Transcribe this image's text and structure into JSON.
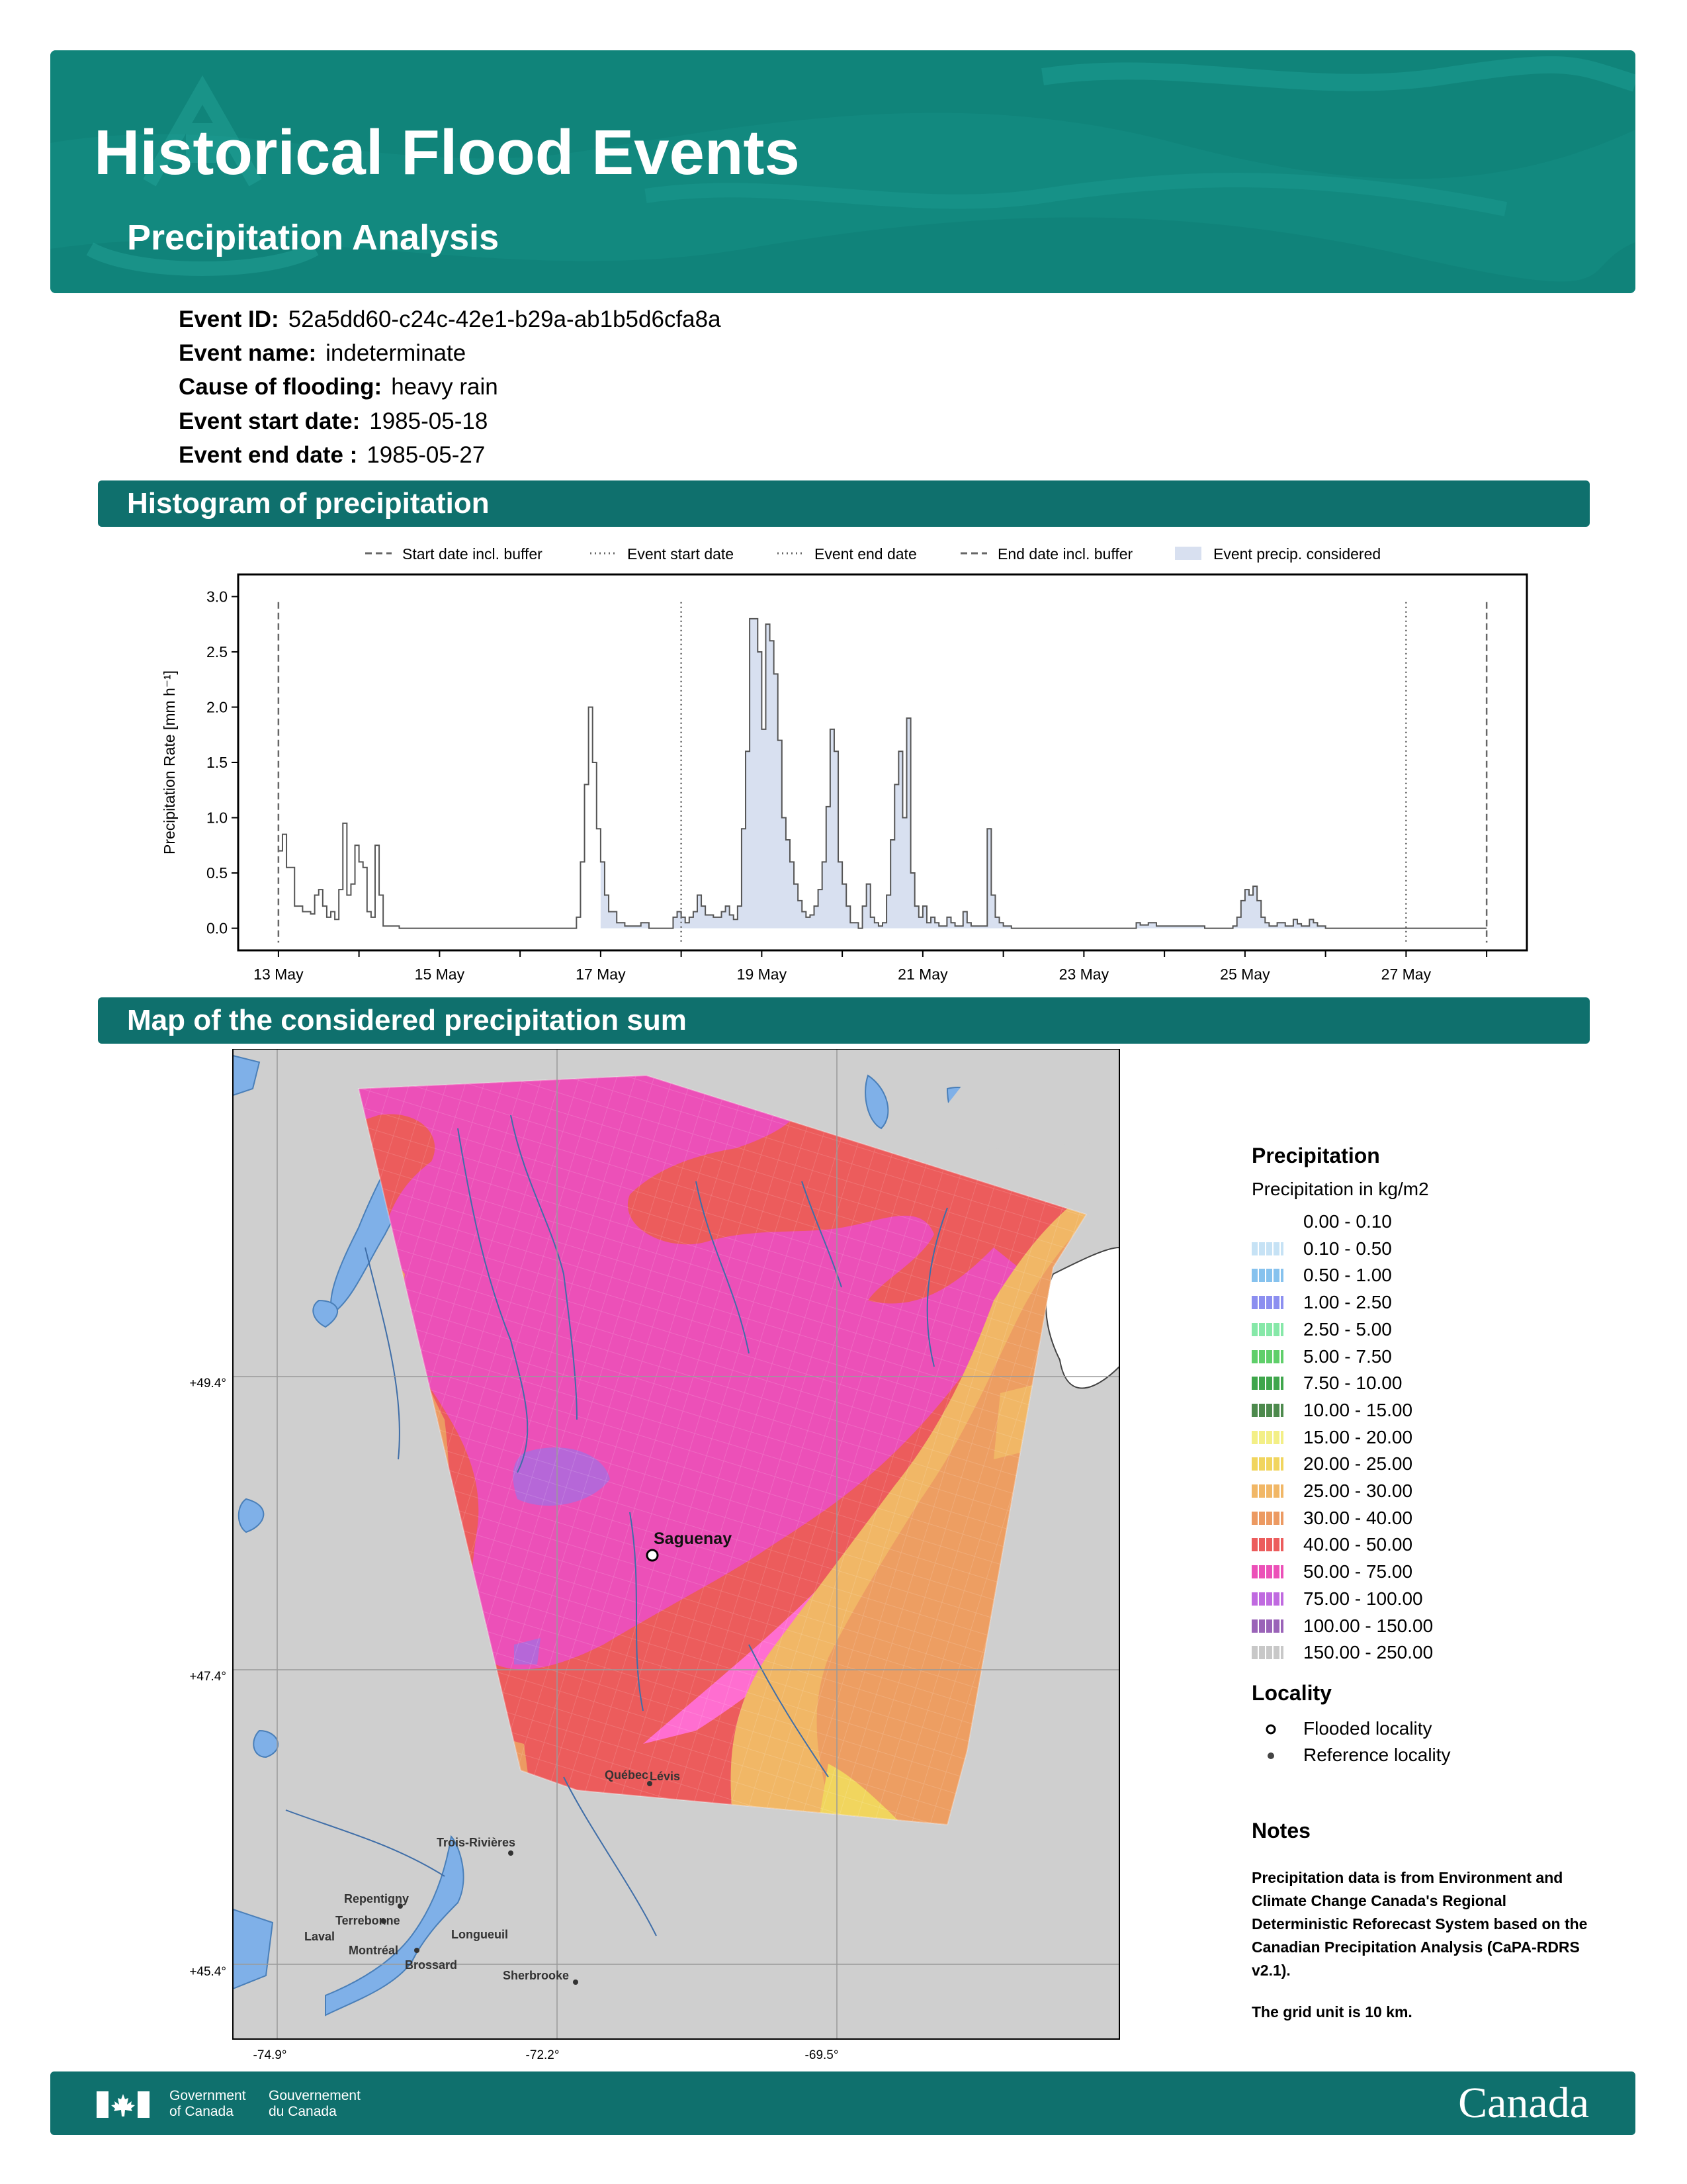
{
  "header": {
    "title": "Historical Flood Events",
    "subtitle": "Precipitation Analysis",
    "brand_color": "#12897f"
  },
  "event": {
    "id_label": "Event ID:",
    "id": "52a5dd60-c24c-42e1-b29a-ab1b5d6cfa8a",
    "name_label": "Event name:",
    "name": "indeterminate",
    "cause_label": "Cause of flooding:",
    "cause": "heavy rain",
    "start_label": "Event start date:",
    "start": "1985-05-18",
    "end_label": "Event end date :",
    "end": "1985-05-27"
  },
  "sections": {
    "histogram": "Histogram of precipitation",
    "map": "Map of the considered precipitation sum"
  },
  "chart_data": {
    "type": "area",
    "title": "",
    "xlabel": "",
    "ylabel": "Precipitation Rate [mm h⁻¹]",
    "ylim": [
      0,
      3.0
    ],
    "xlim": [
      12.5,
      28.5
    ],
    "yticks": [
      "0.0",
      "0.5",
      "1.0",
      "1.5",
      "2.0",
      "2.5",
      "3.0"
    ],
    "xticks": [
      {
        "v": 13,
        "label": "13 May"
      },
      {
        "v": 15,
        "label": "15 May"
      },
      {
        "v": 17,
        "label": "17 May"
      },
      {
        "v": 19,
        "label": "19 May"
      },
      {
        "v": 21,
        "label": "21 May"
      },
      {
        "v": 23,
        "label": "23 May"
      },
      {
        "v": 25,
        "label": "25 May"
      },
      {
        "v": 27,
        "label": "27 May"
      }
    ],
    "legend": [
      "Start date incl. buffer",
      "Event start date",
      "Event end date",
      "End date incl. buffer",
      "Event precip. considered"
    ],
    "legend_placement": "top",
    "vlines": [
      {
        "x": 13.0,
        "style": "dashed"
      },
      {
        "x": 18.0,
        "style": "dotted"
      },
      {
        "x": 27.0,
        "style": "dotted"
      },
      {
        "x": 28.0,
        "style": "dashed"
      }
    ],
    "fill_range": [
      17.0,
      28.0
    ],
    "series": [
      {
        "values": [
          [
            13.0,
            0.7
          ],
          [
            13.05,
            0.85
          ],
          [
            13.1,
            0.55
          ],
          [
            13.15,
            0.55
          ],
          [
            13.2,
            0.2
          ],
          [
            13.3,
            0.15
          ],
          [
            13.4,
            0.13
          ],
          [
            13.45,
            0.3
          ],
          [
            13.5,
            0.35
          ],
          [
            13.55,
            0.2
          ],
          [
            13.6,
            0.1
          ],
          [
            13.65,
            0.15
          ],
          [
            13.7,
            0.08
          ],
          [
            13.75,
            0.35
          ],
          [
            13.8,
            0.95
          ],
          [
            13.85,
            0.3
          ],
          [
            13.9,
            0.4
          ],
          [
            13.95,
            0.75
          ],
          [
            14.0,
            0.6
          ],
          [
            14.05,
            0.55
          ],
          [
            14.1,
            0.15
          ],
          [
            14.15,
            0.1
          ],
          [
            14.2,
            0.75
          ],
          [
            14.25,
            0.3
          ],
          [
            14.3,
            0.02
          ],
          [
            14.5,
            0.0
          ],
          [
            16.6,
            0.0
          ],
          [
            16.7,
            0.1
          ],
          [
            16.75,
            0.6
          ],
          [
            16.8,
            1.3
          ],
          [
            16.85,
            2.0
          ],
          [
            16.9,
            1.5
          ],
          [
            16.95,
            0.9
          ],
          [
            17.0,
            0.6
          ],
          [
            17.05,
            0.3
          ],
          [
            17.1,
            0.15
          ],
          [
            17.2,
            0.05
          ],
          [
            17.3,
            0.02
          ],
          [
            17.5,
            0.05
          ],
          [
            17.6,
            0.0
          ],
          [
            17.9,
            0.1
          ],
          [
            17.95,
            0.15
          ],
          [
            18.0,
            0.1
          ],
          [
            18.05,
            0.05
          ],
          [
            18.1,
            0.1
          ],
          [
            18.15,
            0.15
          ],
          [
            18.2,
            0.3
          ],
          [
            18.25,
            0.2
          ],
          [
            18.3,
            0.12
          ],
          [
            18.4,
            0.1
          ],
          [
            18.5,
            0.15
          ],
          [
            18.55,
            0.2
          ],
          [
            18.6,
            0.12
          ],
          [
            18.65,
            0.08
          ],
          [
            18.7,
            0.2
          ],
          [
            18.75,
            0.9
          ],
          [
            18.8,
            1.6
          ],
          [
            18.85,
            2.8
          ],
          [
            18.9,
            2.8
          ],
          [
            18.95,
            2.5
          ],
          [
            19.0,
            1.8
          ],
          [
            19.05,
            2.75
          ],
          [
            19.1,
            2.6
          ],
          [
            19.15,
            2.3
          ],
          [
            19.2,
            1.7
          ],
          [
            19.25,
            1.0
          ],
          [
            19.3,
            0.8
          ],
          [
            19.35,
            0.6
          ],
          [
            19.4,
            0.4
          ],
          [
            19.45,
            0.25
          ],
          [
            19.5,
            0.15
          ],
          [
            19.55,
            0.1
          ],
          [
            19.6,
            0.12
          ],
          [
            19.65,
            0.2
          ],
          [
            19.7,
            0.35
          ],
          [
            19.75,
            0.6
          ],
          [
            19.8,
            1.1
          ],
          [
            19.85,
            1.8
          ],
          [
            19.9,
            1.6
          ],
          [
            19.95,
            0.6
          ],
          [
            20.0,
            0.4
          ],
          [
            20.05,
            0.2
          ],
          [
            20.1,
            0.05
          ],
          [
            20.2,
            0.0
          ],
          [
            20.25,
            0.2
          ],
          [
            20.3,
            0.4
          ],
          [
            20.35,
            0.1
          ],
          [
            20.4,
            0.05
          ],
          [
            20.45,
            0.02
          ],
          [
            20.5,
            0.05
          ],
          [
            20.55,
            0.3
          ],
          [
            20.6,
            0.8
          ],
          [
            20.65,
            1.3
          ],
          [
            20.7,
            1.6
          ],
          [
            20.75,
            1.0
          ],
          [
            20.8,
            1.9
          ],
          [
            20.85,
            0.5
          ],
          [
            20.9,
            0.2
          ],
          [
            20.95,
            0.1
          ],
          [
            21.0,
            0.2
          ],
          [
            21.05,
            0.05
          ],
          [
            21.1,
            0.1
          ],
          [
            21.15,
            0.05
          ],
          [
            21.2,
            0.02
          ],
          [
            21.3,
            0.1
          ],
          [
            21.35,
            0.05
          ],
          [
            21.4,
            0.02
          ],
          [
            21.5,
            0.15
          ],
          [
            21.55,
            0.05
          ],
          [
            21.6,
            0.02
          ],
          [
            21.8,
            0.9
          ],
          [
            21.85,
            0.3
          ],
          [
            21.9,
            0.1
          ],
          [
            21.95,
            0.05
          ],
          [
            22.0,
            0.02
          ],
          [
            22.1,
            0.0
          ],
          [
            23.6,
            0.0
          ],
          [
            23.65,
            0.05
          ],
          [
            23.7,
            0.03
          ],
          [
            23.8,
            0.05
          ],
          [
            23.9,
            0.02
          ],
          [
            24.1,
            0.02
          ],
          [
            24.5,
            0.0
          ],
          [
            24.85,
            0.02
          ],
          [
            24.9,
            0.1
          ],
          [
            24.95,
            0.25
          ],
          [
            25.0,
            0.35
          ],
          [
            25.05,
            0.3
          ],
          [
            25.1,
            0.38
          ],
          [
            25.15,
            0.25
          ],
          [
            25.2,
            0.1
          ],
          [
            25.25,
            0.05
          ],
          [
            25.3,
            0.02
          ],
          [
            25.4,
            0.05
          ],
          [
            25.5,
            0.02
          ],
          [
            25.6,
            0.08
          ],
          [
            25.65,
            0.04
          ],
          [
            25.7,
            0.02
          ],
          [
            25.8,
            0.08
          ],
          [
            25.85,
            0.05
          ],
          [
            25.9,
            0.02
          ],
          [
            26.0,
            0.0
          ],
          [
            28.0,
            0.0
          ]
        ]
      }
    ]
  },
  "map": {
    "lat_labels": [
      "+49.4°",
      "+47.4°",
      "+45.4°"
    ],
    "lon_labels": [
      "-74.9°",
      "-72.2°",
      "-69.5°"
    ],
    "cities": {
      "flooded": "Saguenay",
      "quebec": "Québec",
      "levis": "Lévis",
      "trois": "Trois-Rivières",
      "repentigny": "Repentigny",
      "terrebonne": "Terrebonne",
      "laval": "Laval",
      "montreal": "Montréal",
      "longueuil": "Longueuil",
      "brossard": "Brossard",
      "sherbrooke": "Sherbrooke"
    }
  },
  "legend": {
    "title": "Precipitation",
    "subtitle": "Precipitation in kg/m2",
    "bins": [
      {
        "label": "0.00 - 0.10",
        "color": "#ffffff"
      },
      {
        "label": "0.10 - 0.50",
        "color": "#c6e2f5"
      },
      {
        "label": "0.50 - 1.00",
        "color": "#86c2ee"
      },
      {
        "label": "1.00 - 2.50",
        "color": "#8c8ff0"
      },
      {
        "label": "2.50 - 5.00",
        "color": "#86e8a8"
      },
      {
        "label": "5.00 - 7.50",
        "color": "#5fcf6a"
      },
      {
        "label": "7.50 - 10.00",
        "color": "#3fa64c"
      },
      {
        "label": "10.00 - 15.00",
        "color": "#4d8a4d"
      },
      {
        "label": "15.00 - 20.00",
        "color": "#f3ef86"
      },
      {
        "label": "20.00 - 25.00",
        "color": "#f1d55e"
      },
      {
        "label": "25.00 - 30.00",
        "color": "#f1b766"
      },
      {
        "label": "30.00 - 40.00",
        "color": "#ec9a62"
      },
      {
        "label": "40.00 - 50.00",
        "color": "#ec5c5c"
      },
      {
        "label": "50.00 - 75.00",
        "color": "#ec50b8"
      },
      {
        "label": "75.00 - 100.00",
        "color": "#c06ae0"
      },
      {
        "label": "100.00 - 150.00",
        "color": "#9a63b8"
      },
      {
        "label": "150.00 - 250.00",
        "color": "#c8c8c8"
      }
    ],
    "locality_title": "Locality",
    "flooded_label": "Flooded locality",
    "reference_label": "Reference locality"
  },
  "notes": {
    "title": "Notes",
    "body": "Precipitation data is from Environment and Climate Change Canada's Regional Deterministic Reforecast System based on the Canadian Precipitation Analysis (CaPA-RDRS v2.1).",
    "grid": "The grid unit is 10 km."
  },
  "footer": {
    "gov_en": "Government\nof Canada",
    "gov_fr": "Gouvernement\ndu Canada",
    "wordmark": "Canada"
  }
}
